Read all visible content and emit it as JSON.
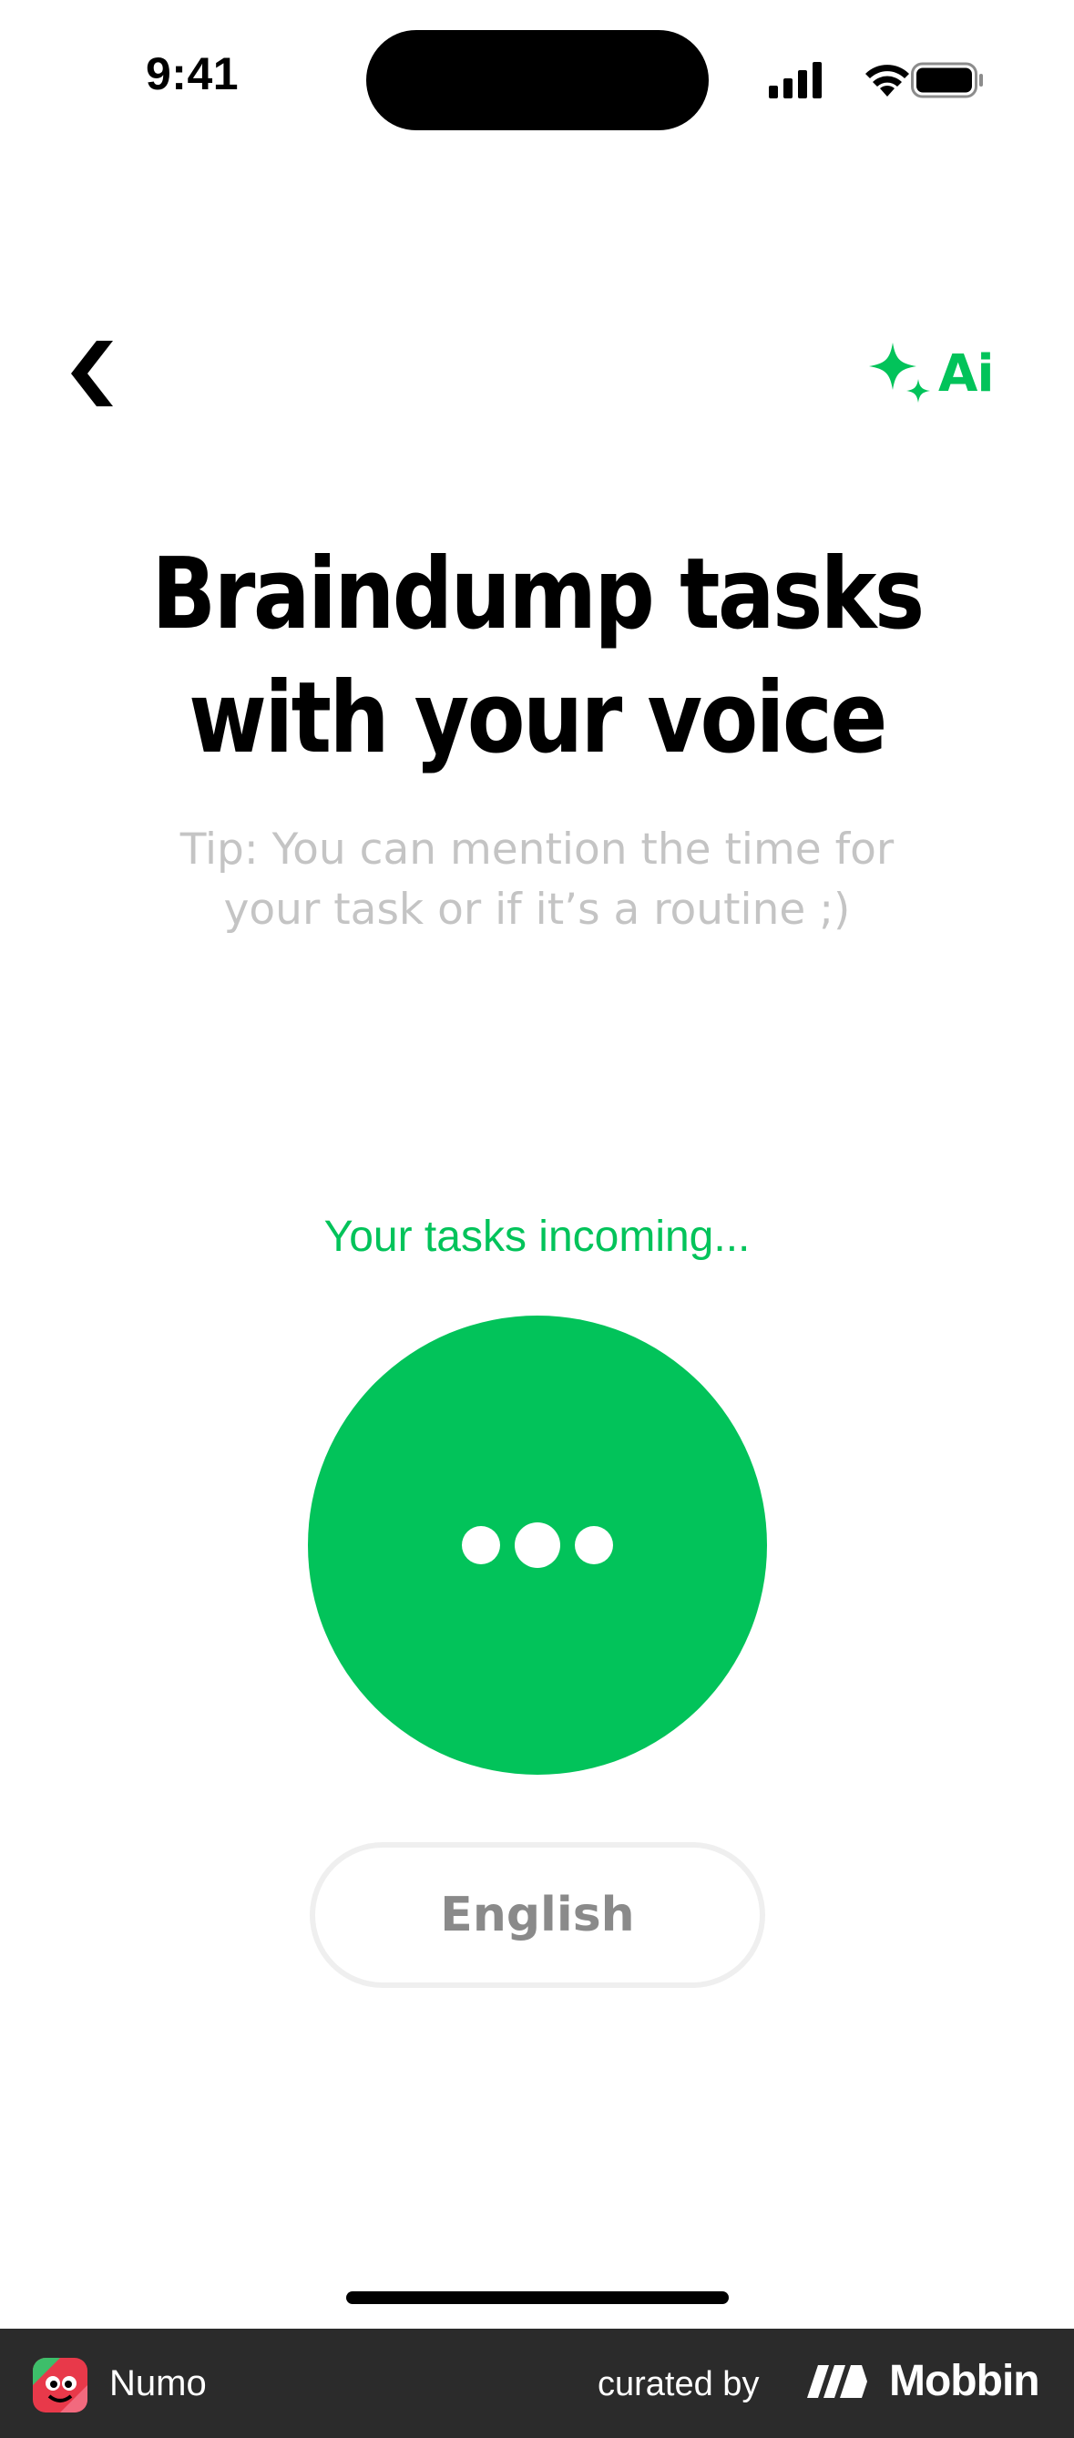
{
  "status_bar": {
    "time": "9:41"
  },
  "header": {
    "back_icon": "chevron-left-icon",
    "ai_label": "Ai",
    "ai_icon": "sparkle-icon"
  },
  "headline": {
    "line1": "Braindump tasks",
    "line2": "with your voice"
  },
  "tip": {
    "line1": "Tip: You can mention the time for",
    "line2": "your task or if it’s a routine ;)"
  },
  "recording": {
    "status": "Your tasks incoming...",
    "indicator_icon": "ellipsis-icon"
  },
  "language_button": {
    "label": "English"
  },
  "footer": {
    "app_name": "Numo",
    "curated_by": "curated by",
    "brand": "Mobbin"
  },
  "colors": {
    "accent": "#02C35A",
    "tip_text": "#C4C4C4",
    "footer_bg": "#2B2B2B"
  }
}
